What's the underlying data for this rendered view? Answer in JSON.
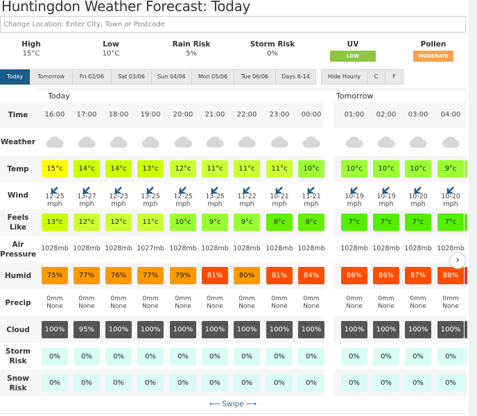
{
  "title": "Huntingdon Weather Forecast: Today",
  "location": {
    "placeholder": "Change Location: Enter City, Town or Postcode"
  },
  "summary": {
    "high": {
      "label": "High",
      "value": "15°C"
    },
    "low": {
      "label": "Low",
      "value": "10°C"
    },
    "rain": {
      "label": "Rain Risk",
      "value": "5%"
    },
    "storm": {
      "label": "Storm Risk",
      "value": "0%"
    },
    "uv": {
      "label": "UV",
      "value": "LOW",
      "color": "#8dc63f"
    },
    "pollen": {
      "label": "Pollen",
      "value": "MODERATE",
      "color": "#f7a24b"
    }
  },
  "tabs": [
    "Today",
    "Tomorrow",
    "Fri 02/06",
    "Sat 03/06",
    "Sun 04/06",
    "Mon 05/06",
    "Tue 06/06",
    "Days 8-14"
  ],
  "tabs_right": [
    "Hide Hourly",
    "C",
    "F"
  ],
  "day_headers": [
    "Today",
    "Tomorrow"
  ],
  "row_labels": {
    "time": "Time",
    "weather": "Weather",
    "temp": "Temp",
    "wind": "Wind",
    "feels1": "Feels",
    "feels2": "Like",
    "air1": "Air",
    "air2": "Pressure",
    "humid": "Humid",
    "precip": "Precip",
    "cloud": "Cloud",
    "storm1": "Storm",
    "storm2": "Risk",
    "snow1": "Snow",
    "snow2": "Risk"
  },
  "hours": [
    {
      "time": "16:00",
      "weather": "cloudy",
      "temp": "15°c",
      "temp_color": "#ffff00",
      "wind": "12-25",
      "wind_unit": "mph",
      "feels": "13°c",
      "feels_color": "#ccff00",
      "pressure": "1028mb",
      "humid": "75%",
      "humid_color": "#ff9900",
      "precip": "0mm",
      "precip_type": "None",
      "cloud": "100%",
      "storm": "0%",
      "snow": "0%"
    },
    {
      "time": "17:00",
      "weather": "cloudy",
      "temp": "14°c",
      "temp_color": "#ccff00",
      "wind": "13-27",
      "wind_unit": "mph",
      "feels": "12°c",
      "feels_color": "#ccff33",
      "pressure": "1028mb",
      "humid": "77%",
      "humid_color": "#ff9900",
      "precip": "0mm",
      "precip_type": "None",
      "cloud": "95%",
      "storm": "0%",
      "snow": "0%"
    },
    {
      "time": "18:00",
      "weather": "cloudy",
      "temp": "14°c",
      "temp_color": "#ccff00",
      "wind": "12-23",
      "wind_unit": "mph",
      "feels": "12°c",
      "feels_color": "#ccff33",
      "pressure": "1028mb",
      "humid": "76%",
      "humid_color": "#ff9900",
      "precip": "0mm",
      "precip_type": "None",
      "cloud": "100%",
      "storm": "0%",
      "snow": "0%"
    },
    {
      "time": "19:00",
      "weather": "cloudy",
      "temp": "13°c",
      "temp_color": "#ccff00",
      "wind": "13-25",
      "wind_unit": "mph",
      "feels": "11°c",
      "feels_color": "#ccff33",
      "pressure": "1027mb",
      "humid": "77%",
      "humid_color": "#ff9900",
      "precip": "0mm",
      "precip_type": "None",
      "cloud": "100%",
      "storm": "0%",
      "snow": "0%"
    },
    {
      "time": "20:00",
      "weather": "cloudy",
      "temp": "12°c",
      "temp_color": "#ccff33",
      "wind": "12-25",
      "wind_unit": "mph",
      "feels": "10°c",
      "feels_color": "#99ff33",
      "pressure": "1028mb",
      "humid": "79%",
      "humid_color": "#ff9900",
      "precip": "0mm",
      "precip_type": "None",
      "cloud": "100%",
      "storm": "0%",
      "snow": "0%"
    },
    {
      "time": "21:00",
      "weather": "cloudy",
      "temp": "11°c",
      "temp_color": "#ccff33",
      "wind": "13-25",
      "wind_unit": "mph",
      "feels": "9°c",
      "feels_color": "#99ff33",
      "pressure": "1028mb",
      "humid": "81%",
      "humid_color": "#ff4c00",
      "precip": "0mm",
      "precip_type": "None",
      "cloud": "100%",
      "storm": "0%",
      "snow": "0%"
    },
    {
      "time": "22:00",
      "weather": "cloudy",
      "temp": "11°c",
      "temp_color": "#ccff33",
      "wind": "11-22",
      "wind_unit": "mph",
      "feels": "9°c",
      "feels_color": "#99ff33",
      "pressure": "1028mb",
      "humid": "80%",
      "humid_color": "#ff9900",
      "precip": "0mm",
      "precip_type": "None",
      "cloud": "100%",
      "storm": "0%",
      "snow": "0%"
    },
    {
      "time": "23:00",
      "weather": "cloudy",
      "temp": "11°c",
      "temp_color": "#ccff33",
      "wind": "10-21",
      "wind_unit": "mph",
      "feels": "8°c",
      "feels_color": "#66ee00",
      "pressure": "1028mb",
      "humid": "81%",
      "humid_color": "#ff4c00",
      "precip": "0mm",
      "precip_type": "None",
      "cloud": "100%",
      "storm": "0%",
      "snow": "0%"
    },
    {
      "time": "00:00",
      "weather": "cloudy",
      "temp": "10°c",
      "temp_color": "#99ff33",
      "wind": "11-21",
      "wind_unit": "mph",
      "feels": "8°c",
      "feels_color": "#66ee00",
      "pressure": "1028mb",
      "humid": "84%",
      "humid_color": "#ff4c00",
      "precip": "0mm",
      "precip_type": "None",
      "cloud": "100%",
      "storm": "0%",
      "snow": "0%"
    },
    {
      "time": "01:00",
      "weather": "cloudy",
      "temp": "10°c",
      "temp_color": "#99ff33",
      "wind": "10-19",
      "wind_unit": "mph",
      "feels": "7°c",
      "feels_color": "#55ee00",
      "pressure": "1028mb",
      "humid": "86%",
      "humid_color": "#ff4c00",
      "precip": "0mm",
      "precip_type": "None",
      "cloud": "100%",
      "storm": "0%",
      "snow": "0%"
    },
    {
      "time": "02:00",
      "weather": "cloudy",
      "temp": "10°c",
      "temp_color": "#99ff33",
      "wind": "10-19",
      "wind_unit": "mph",
      "feels": "7°c",
      "feels_color": "#55ee00",
      "pressure": "1028mb",
      "humid": "86%",
      "humid_color": "#ff4c00",
      "precip": "0mm",
      "precip_type": "None",
      "cloud": "100%",
      "storm": "0%",
      "snow": "0%"
    },
    {
      "time": "03:00",
      "weather": "cloudy",
      "temp": "10°c",
      "temp_color": "#99ff33",
      "wind": "10-20",
      "wind_unit": "mph",
      "feels": "7°c",
      "feels_color": "#55ee00",
      "pressure": "1028mb",
      "humid": "87%",
      "humid_color": "#ff4c00",
      "precip": "0mm",
      "precip_type": "None",
      "cloud": "100%",
      "storm": "0%",
      "snow": "0%"
    },
    {
      "time": "04:00",
      "weather": "cloudy",
      "temp": "9°c",
      "temp_color": "#99ff33",
      "wind": "10-20",
      "wind_unit": "mph",
      "feels": "7°c",
      "feels_color": "#55ee00",
      "pressure": "1028mb",
      "humid": "88%",
      "humid_color": "#ff4c00",
      "precip": "0mm",
      "precip_type": "None",
      "cloud": "100%",
      "storm": "0%",
      "snow": "0%"
    }
  ],
  "colors": {
    "cloud_cell": "#555555",
    "risk_cell": "#d9fcf5",
    "cloud_icon": "#d7d7d7",
    "wind_arrow": "#1b5c8b",
    "partial_temp": "#99ff33",
    "partial_feels": "#55ee00",
    "partial_humid": "#ee3333"
  },
  "swipe": "Swipe",
  "next_icon": "chevron-right"
}
